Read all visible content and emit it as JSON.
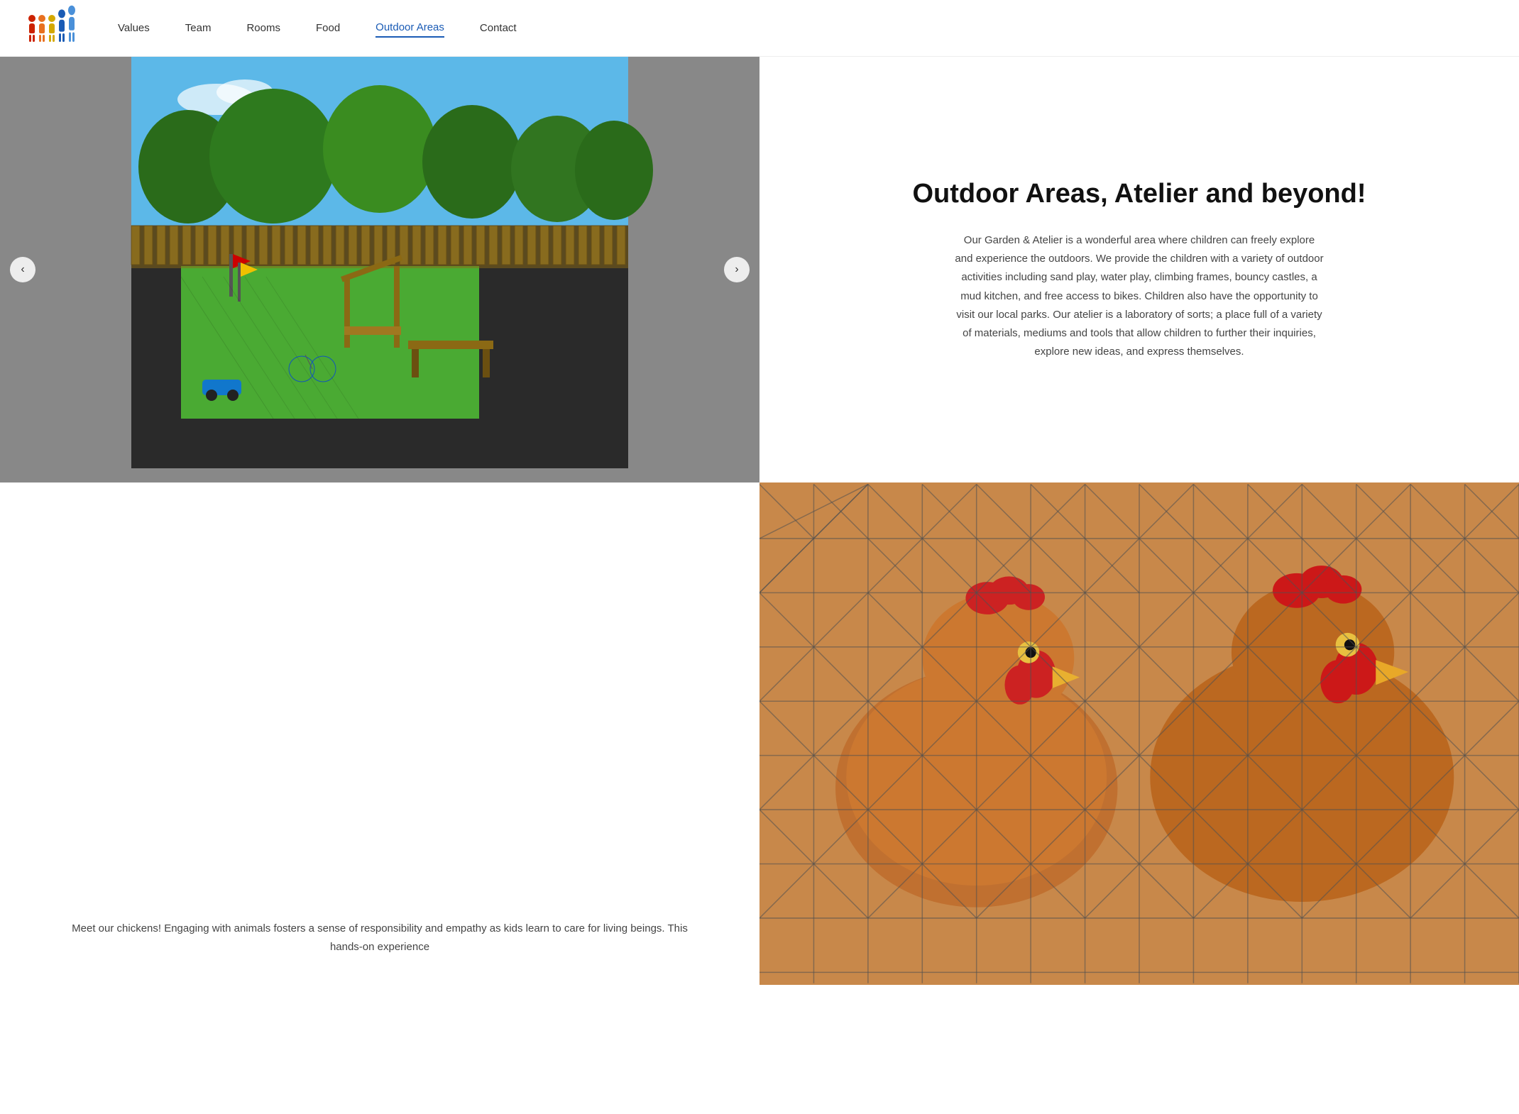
{
  "header": {
    "logo_alt": "People figures logo",
    "nav_items": [
      {
        "label": "Values",
        "href": "#values",
        "active": false
      },
      {
        "label": "Team",
        "href": "#team",
        "active": false
      },
      {
        "label": "Rooms",
        "href": "#rooms",
        "active": false
      },
      {
        "label": "Food",
        "href": "#food",
        "active": false
      },
      {
        "label": "Outdoor Areas",
        "href": "#outdoor",
        "active": true
      },
      {
        "label": "Contact",
        "href": "#contact",
        "active": false
      }
    ]
  },
  "outdoor_section": {
    "title": "Outdoor Areas, Atelier and beyond!",
    "description": "Our Garden & Atelier is a wonderful area where children can freely explore and experience the outdoors. We provide the children with a variety of outdoor activities including sand play, water play, climbing frames, bouncy castles, a mud kitchen, and free access to bikes. Children also have the opportunity to visit our local parks. Our atelier is a laboratory of sorts; a place full of a variety of materials, mediums and tools that allow children to further their inquiries, explore new ideas, and express themselves.",
    "slider_prev_label": "‹",
    "slider_next_label": "›"
  },
  "chicken_section": {
    "description": "Meet our chickens! Engaging with animals fosters a sense of responsibility and empathy as kids learn to care for living beings. This hands-on experience"
  }
}
